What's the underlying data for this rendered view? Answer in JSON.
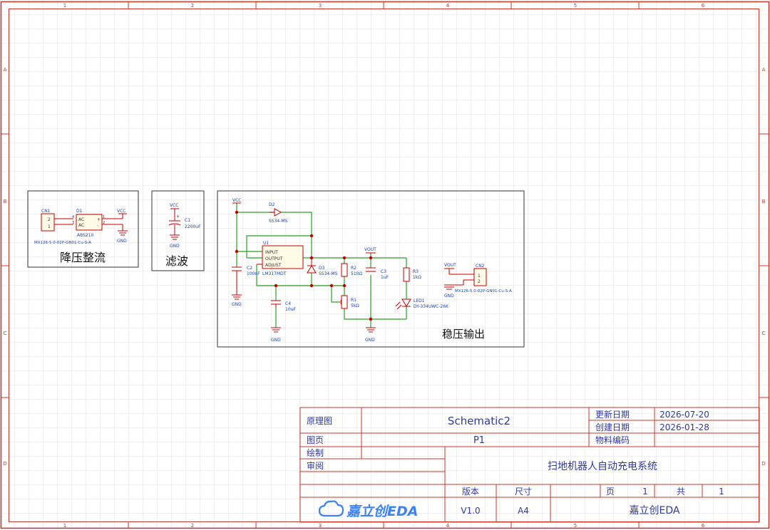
{
  "frame": {
    "col_labels": [
      "1",
      "2",
      "3",
      "4",
      "5",
      "6"
    ],
    "row_labels": [
      "A",
      "B",
      "C",
      "D"
    ]
  },
  "colors": {
    "border": "#c0392b",
    "wire": "#2aa02a",
    "component": "#c00000",
    "text": "#1a3fb0",
    "title_text": "#2f3a9c",
    "grid": "#d8d8d8",
    "logo": "#3b82f6"
  },
  "blocks": {
    "rectifier": {
      "title": "降压整流",
      "cn1_ref": "CN1",
      "cn1_pins": [
        "2",
        "1"
      ],
      "cn1_part": "MX126-5.0-02P-GN01-Cu-S-A",
      "d1_ref": "D1",
      "d1_pins": [
        "4",
        "3",
        "1",
        "2"
      ],
      "d1_ac1": "AC",
      "d1_ac2": "AC",
      "d1_plus": "+",
      "d1_minus": "-",
      "d1_part": "ABS210",
      "vcc": "VCC",
      "gnd": "GND"
    },
    "filter": {
      "title": "滤波",
      "vcc": "VCC",
      "c1_ref": "C1",
      "c1_value": "2200uF",
      "plus": "+",
      "gnd": "GND"
    },
    "regulator": {
      "title": "稳压输出",
      "vcc": "VCC",
      "d2_ref": "D2",
      "d2_part": "SS34-MS",
      "u1_ref": "U1",
      "u1_pins": [
        "INPUT",
        "OUTPUT",
        "ADJUST"
      ],
      "u1_part": "LM317MDT",
      "c2_ref": "C2",
      "c2_value": "100nF",
      "d3_ref": "D3",
      "d3_part": "SS34-MS",
      "r2_ref": "R2",
      "r2_value": "510Ω",
      "vout": "VOUT",
      "c3_ref": "C3",
      "c3_value": "1uF",
      "r3_ref": "R3",
      "r3_value": "1kΩ",
      "led1_ref": "LED1",
      "led1_part": "DY-334UWC-26K",
      "r1_ref": "R1",
      "r1_value": "5kΩ",
      "c4_ref": "C4",
      "c4_value": "10uF",
      "gnd": "GND",
      "vout2": "VOUT",
      "cn2_ref": "CN2",
      "cn2_pins": [
        "1",
        "2"
      ],
      "cn2_part": "MX126-5.0-02P-GN01-Cu-S-A",
      "gnd2": "GND"
    }
  },
  "title_block": {
    "type_label": "原理图",
    "schematic_name": "Schematic2",
    "page_label": "图页",
    "page_value": "P1",
    "drawn_label": "绘制",
    "review_label": "审阅",
    "updated_label": "更新日期",
    "updated_value": "2026-07-20",
    "created_label": "创建日期",
    "created_value": "2026-01-28",
    "material_label": "物料编码",
    "project_name": "扫地机器人自动充电系统",
    "version_label": "版本",
    "version_value": "V1.0",
    "size_label": "尺寸",
    "size_value": "A4",
    "page_num_label": "页",
    "page_num_value": "1",
    "total_label": "共",
    "total_value": "1",
    "logo_text": "嘉立创EDA",
    "company": "嘉立创EDA"
  }
}
